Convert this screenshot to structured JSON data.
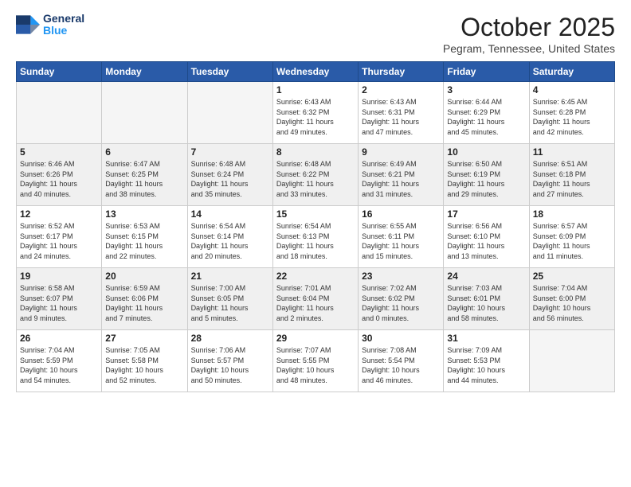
{
  "logo": {
    "line1": "General",
    "line2": "Blue"
  },
  "title": "October 2025",
  "location": "Pegram, Tennessee, United States",
  "weekdays": [
    "Sunday",
    "Monday",
    "Tuesday",
    "Wednesday",
    "Thursday",
    "Friday",
    "Saturday"
  ],
  "weeks": [
    {
      "shaded": false,
      "days": [
        {
          "num": "",
          "info": "",
          "empty": true
        },
        {
          "num": "",
          "info": "",
          "empty": true
        },
        {
          "num": "",
          "info": "",
          "empty": true
        },
        {
          "num": "1",
          "info": "Sunrise: 6:43 AM\nSunset: 6:32 PM\nDaylight: 11 hours\nand 49 minutes.",
          "empty": false
        },
        {
          "num": "2",
          "info": "Sunrise: 6:43 AM\nSunset: 6:31 PM\nDaylight: 11 hours\nand 47 minutes.",
          "empty": false
        },
        {
          "num": "3",
          "info": "Sunrise: 6:44 AM\nSunset: 6:29 PM\nDaylight: 11 hours\nand 45 minutes.",
          "empty": false
        },
        {
          "num": "4",
          "info": "Sunrise: 6:45 AM\nSunset: 6:28 PM\nDaylight: 11 hours\nand 42 minutes.",
          "empty": false
        }
      ]
    },
    {
      "shaded": true,
      "days": [
        {
          "num": "5",
          "info": "Sunrise: 6:46 AM\nSunset: 6:26 PM\nDaylight: 11 hours\nand 40 minutes.",
          "empty": false
        },
        {
          "num": "6",
          "info": "Sunrise: 6:47 AM\nSunset: 6:25 PM\nDaylight: 11 hours\nand 38 minutes.",
          "empty": false
        },
        {
          "num": "7",
          "info": "Sunrise: 6:48 AM\nSunset: 6:24 PM\nDaylight: 11 hours\nand 35 minutes.",
          "empty": false
        },
        {
          "num": "8",
          "info": "Sunrise: 6:48 AM\nSunset: 6:22 PM\nDaylight: 11 hours\nand 33 minutes.",
          "empty": false
        },
        {
          "num": "9",
          "info": "Sunrise: 6:49 AM\nSunset: 6:21 PM\nDaylight: 11 hours\nand 31 minutes.",
          "empty": false
        },
        {
          "num": "10",
          "info": "Sunrise: 6:50 AM\nSunset: 6:19 PM\nDaylight: 11 hours\nand 29 minutes.",
          "empty": false
        },
        {
          "num": "11",
          "info": "Sunrise: 6:51 AM\nSunset: 6:18 PM\nDaylight: 11 hours\nand 27 minutes.",
          "empty": false
        }
      ]
    },
    {
      "shaded": false,
      "days": [
        {
          "num": "12",
          "info": "Sunrise: 6:52 AM\nSunset: 6:17 PM\nDaylight: 11 hours\nand 24 minutes.",
          "empty": false
        },
        {
          "num": "13",
          "info": "Sunrise: 6:53 AM\nSunset: 6:15 PM\nDaylight: 11 hours\nand 22 minutes.",
          "empty": false
        },
        {
          "num": "14",
          "info": "Sunrise: 6:54 AM\nSunset: 6:14 PM\nDaylight: 11 hours\nand 20 minutes.",
          "empty": false
        },
        {
          "num": "15",
          "info": "Sunrise: 6:54 AM\nSunset: 6:13 PM\nDaylight: 11 hours\nand 18 minutes.",
          "empty": false
        },
        {
          "num": "16",
          "info": "Sunrise: 6:55 AM\nSunset: 6:11 PM\nDaylight: 11 hours\nand 15 minutes.",
          "empty": false
        },
        {
          "num": "17",
          "info": "Sunrise: 6:56 AM\nSunset: 6:10 PM\nDaylight: 11 hours\nand 13 minutes.",
          "empty": false
        },
        {
          "num": "18",
          "info": "Sunrise: 6:57 AM\nSunset: 6:09 PM\nDaylight: 11 hours\nand 11 minutes.",
          "empty": false
        }
      ]
    },
    {
      "shaded": true,
      "days": [
        {
          "num": "19",
          "info": "Sunrise: 6:58 AM\nSunset: 6:07 PM\nDaylight: 11 hours\nand 9 minutes.",
          "empty": false
        },
        {
          "num": "20",
          "info": "Sunrise: 6:59 AM\nSunset: 6:06 PM\nDaylight: 11 hours\nand 7 minutes.",
          "empty": false
        },
        {
          "num": "21",
          "info": "Sunrise: 7:00 AM\nSunset: 6:05 PM\nDaylight: 11 hours\nand 5 minutes.",
          "empty": false
        },
        {
          "num": "22",
          "info": "Sunrise: 7:01 AM\nSunset: 6:04 PM\nDaylight: 11 hours\nand 2 minutes.",
          "empty": false
        },
        {
          "num": "23",
          "info": "Sunrise: 7:02 AM\nSunset: 6:02 PM\nDaylight: 11 hours\nand 0 minutes.",
          "empty": false
        },
        {
          "num": "24",
          "info": "Sunrise: 7:03 AM\nSunset: 6:01 PM\nDaylight: 10 hours\nand 58 minutes.",
          "empty": false
        },
        {
          "num": "25",
          "info": "Sunrise: 7:04 AM\nSunset: 6:00 PM\nDaylight: 10 hours\nand 56 minutes.",
          "empty": false
        }
      ]
    },
    {
      "shaded": false,
      "days": [
        {
          "num": "26",
          "info": "Sunrise: 7:04 AM\nSunset: 5:59 PM\nDaylight: 10 hours\nand 54 minutes.",
          "empty": false
        },
        {
          "num": "27",
          "info": "Sunrise: 7:05 AM\nSunset: 5:58 PM\nDaylight: 10 hours\nand 52 minutes.",
          "empty": false
        },
        {
          "num": "28",
          "info": "Sunrise: 7:06 AM\nSunset: 5:57 PM\nDaylight: 10 hours\nand 50 minutes.",
          "empty": false
        },
        {
          "num": "29",
          "info": "Sunrise: 7:07 AM\nSunset: 5:55 PM\nDaylight: 10 hours\nand 48 minutes.",
          "empty": false
        },
        {
          "num": "30",
          "info": "Sunrise: 7:08 AM\nSunset: 5:54 PM\nDaylight: 10 hours\nand 46 minutes.",
          "empty": false
        },
        {
          "num": "31",
          "info": "Sunrise: 7:09 AM\nSunset: 5:53 PM\nDaylight: 10 hours\nand 44 minutes.",
          "empty": false
        },
        {
          "num": "",
          "info": "",
          "empty": true
        }
      ]
    }
  ]
}
